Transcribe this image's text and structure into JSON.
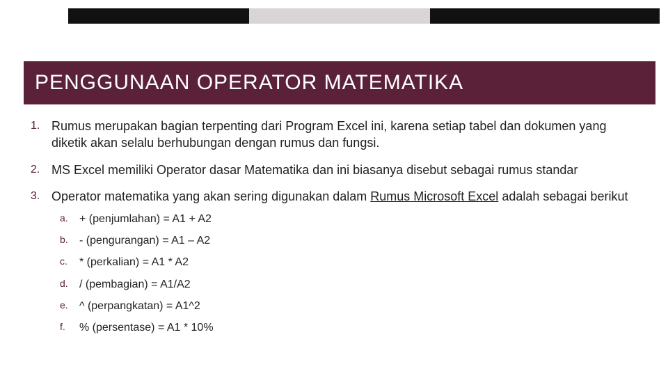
{
  "title": "PENGGUNAAN OPERATOR MATEMATIKA",
  "points": [
    {
      "text": "Rumus merupakan bagian terpenting dari Program Excel ini, karena setiap tabel dan dokumen yang diketik akan selalu berhubungan dengan rumus dan fungsi."
    },
    {
      "text": "MS Excel memiliki Operator dasar Matematika dan ini biasanya disebut sebagai rumus standar"
    },
    {
      "text_before": "Operator matematika yang akan sering digunakan dalam ",
      "underlined": "Rumus Microsoft Excel",
      "text_after": " adalah sebagai berikut",
      "sub": [
        "+ (penjumlahan) = A1 + A2",
        "- (pengurangan) = A1 – A2",
        "* (perkalian) = A1 * A2",
        "/ (pembagian) = A1/A2",
        "^ (perpangkatan) = A1^2",
        "% (persentase) = A1 * 10%"
      ]
    }
  ]
}
